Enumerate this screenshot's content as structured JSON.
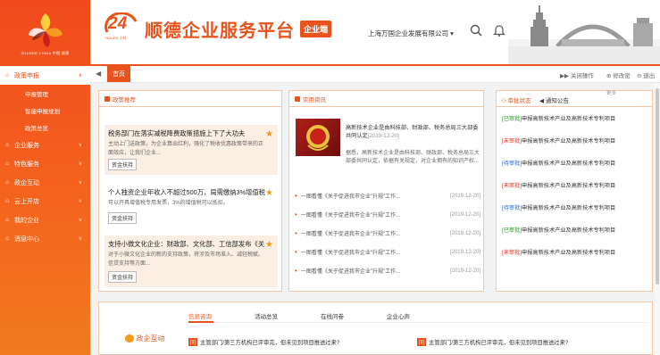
{
  "sidebar": {
    "logo_caption": "SHUNDE CHINA 中国·顺德",
    "items": [
      {
        "label": "政策申报",
        "active": true
      },
      {
        "label": "企业服务"
      },
      {
        "label": "特色服务"
      },
      {
        "label": "政企互动"
      },
      {
        "label": "云上开店"
      },
      {
        "label": "我的企业"
      },
      {
        "label": "消息中心"
      }
    ],
    "sub_items": [
      "申报管理",
      "智能申报规划",
      "政策总览"
    ]
  },
  "header": {
    "logo_number": "24",
    "logo_sub": "HOURS 小时",
    "title": "顺德企业服务平台",
    "tag": "企业端",
    "company": "上海万国企业发展有限公司",
    "company_caret": "▾"
  },
  "tabs": {
    "prev": "◀",
    "home": "首页",
    "close_action": "关闭操作",
    "change_password": "修改密",
    "logout": "退出"
  },
  "policy": {
    "title": "政策推荐",
    "cards": [
      {
        "title": "税务部门在落实减税降费政策措施上下了大功夫",
        "desc": "主动上门送政策，为企业算出红利，强化了税收优惠政策带来的正面效应，让我们企业...",
        "tag": "资金扶持"
      },
      {
        "title": "个人独资企业年收入不超过500万，局需缴纳3%增值税...",
        "desc": "可以开具增值税专用发票，3%的增值税可以抵扣。",
        "tag": "资金扶持"
      },
      {
        "title": "支持小微文化企业：财政部、文化部、工信部发布《关...",
        "desc": "对于小微文化企业的新的支持政策，将涉及市场准入、减轻税赋、信贷支持等方面...",
        "tag": "资金扶持"
      }
    ]
  },
  "news": {
    "title": "实用资讯",
    "featured_title": "高新技术企业是由科技部、财政部、税务总局三大部委共同认定",
    "featured_date": "[2019-12-20]",
    "featured_desc": "据悉，高新技术企业是由科技部、财政部、税务总局三大部委共同认定，依据有关规定，对企业拥有的知识产权...",
    "items": [
      {
        "text": "一图看懂《关于促进我市企业\"升规\"工作...",
        "date": "[2019-12-20]"
      },
      {
        "text": "一图看懂《关于促进我市企业\"升规\"工作...",
        "date": "[2019-12-20]"
      },
      {
        "text": "一图看懂《关于促进我市企业\"升规\"工作...",
        "date": "[2019-12-20]"
      },
      {
        "text": "一图看懂《关于促进我市企业\"升规\"工作...",
        "date": "[2019-12-20]"
      },
      {
        "text": "一图看懂《关于促进我市企业\"升规\"工作...",
        "date": "[2019-12-20]"
      }
    ]
  },
  "approve": {
    "tab_status": "审批状态",
    "tab_notice": "通知公告",
    "more": "更多",
    "rows": [
      {
        "status": "[已审批]",
        "kind": "g",
        "text": "申报高新技术产业及高新技术专利项目"
      },
      {
        "status": "[未审批]",
        "kind": "r",
        "text": "申报高新技术产业及高新技术专利项目"
      },
      {
        "status": "[待审批]",
        "kind": "b",
        "text": "申报高新技术产业及高新技术专利项目"
      },
      {
        "status": "[未审批]",
        "kind": "r",
        "text": "申报高新技术产业及高新技术专利项目"
      },
      {
        "status": "[待审批]",
        "kind": "b",
        "text": "申报高新技术产业及高新技术专利项目"
      },
      {
        "status": "[已审批]",
        "kind": "g",
        "text": "申报高新技术产业及高新技术专利项目"
      },
      {
        "status": "[未审批]",
        "kind": "r",
        "text": "申报高新技术产业及高新技术专利项目"
      }
    ]
  },
  "interaction": {
    "side_label": "政企互动",
    "tabs": [
      "信息咨询",
      "活动总览",
      "在线问卷",
      "企业心声"
    ],
    "q_icon": "问",
    "questions": [
      "主管部门/第三方机构已评审完，但未见到项目推送过来?",
      "主管部门/第三方机构已评审完，但未见到项目推送过来?"
    ]
  },
  "colors": {
    "accent": "#e8531d",
    "approved": "#2a9a2a",
    "pending_red": "#d83a2a",
    "waiting_blue": "#2a6ad8"
  }
}
